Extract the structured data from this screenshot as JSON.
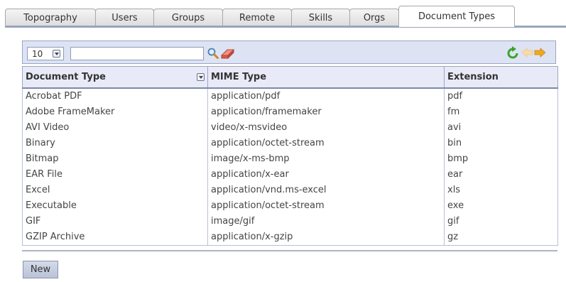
{
  "tabs": [
    {
      "label": "Topography",
      "active": false
    },
    {
      "label": "Users",
      "active": false
    },
    {
      "label": "Groups",
      "active": false
    },
    {
      "label": "Remote",
      "active": false
    },
    {
      "label": "Skills",
      "active": false
    },
    {
      "label": "Orgs",
      "active": false
    },
    {
      "label": "Document Types",
      "active": true
    }
  ],
  "toolbar": {
    "page_size": "10",
    "search_value": "",
    "icons": [
      "search-icon",
      "eraser-icon",
      "refresh-icon",
      "prev-arrow-icon",
      "next-arrow-icon"
    ]
  },
  "table": {
    "columns": [
      "Document Type",
      "MIME Type",
      "Extension"
    ],
    "rows": [
      [
        "Acrobat PDF",
        "application/pdf",
        "pdf"
      ],
      [
        "Adobe FrameMaker",
        "application/framemaker",
        "fm"
      ],
      [
        "AVI Video",
        "video/x-msvideo",
        "avi"
      ],
      [
        "Binary",
        "application/octet-stream",
        "bin"
      ],
      [
        "Bitmap",
        "image/x-ms-bmp",
        "bmp"
      ],
      [
        "EAR File",
        "application/x-ear",
        "ear"
      ],
      [
        "Excel",
        "application/vnd.ms-excel",
        "xls"
      ],
      [
        "Executable",
        "application/octet-stream",
        "exe"
      ],
      [
        "GIF",
        "image/gif",
        "gif"
      ],
      [
        "GZIP Archive",
        "application/x-gzip",
        "gz"
      ]
    ]
  },
  "actions": {
    "new_label": "New"
  },
  "colors": {
    "accent": "#dde3f3",
    "header": "#e8ebf7",
    "border": "#9aa6c7",
    "refresh": "#3aa52a",
    "arrow": "#f2a81d"
  }
}
